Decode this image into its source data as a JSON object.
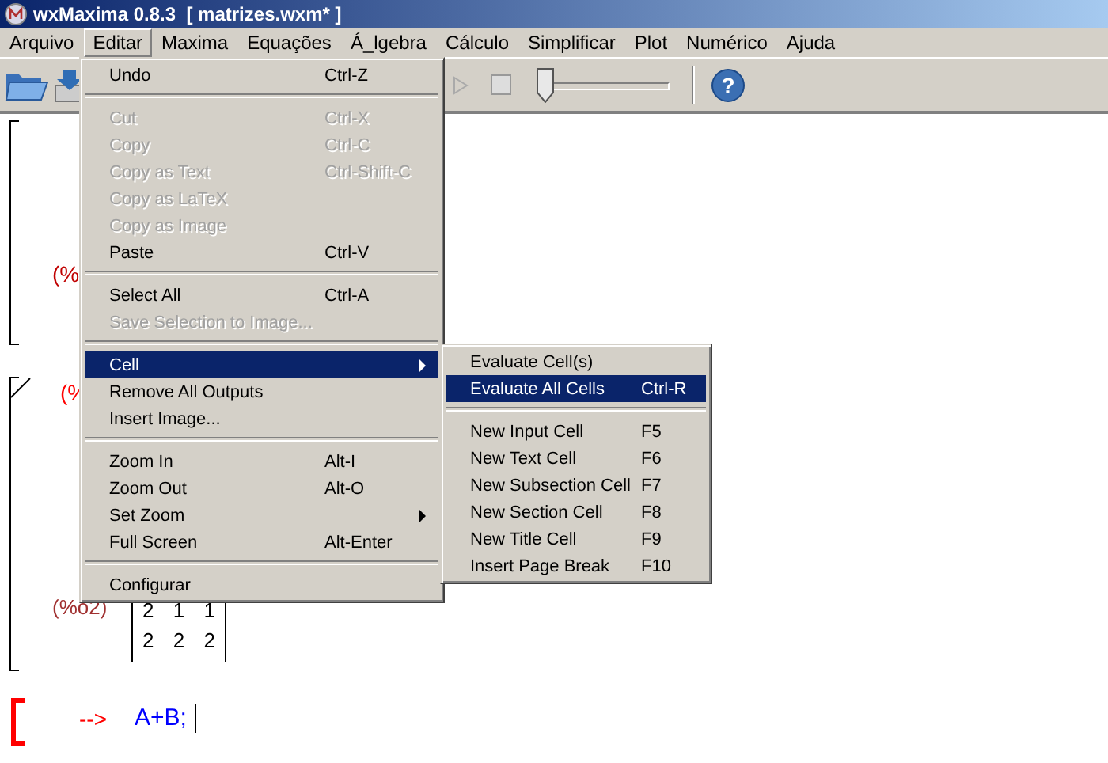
{
  "window": {
    "title": "wxMaxima 0.8.3  [ matrizes.wxm* ]"
  },
  "menubar": [
    {
      "label": "Arquivo",
      "selected": false
    },
    {
      "label": "Editar",
      "selected": true
    },
    {
      "label": "Maxima",
      "selected": false
    },
    {
      "label": "Equações",
      "selected": false
    },
    {
      "label": "Á_lgebra",
      "selected": false
    },
    {
      "label": "Cálculo",
      "selected": false
    },
    {
      "label": "Simplificar",
      "selected": false
    },
    {
      "label": "Plot",
      "selected": false
    },
    {
      "label": "Numérico",
      "selected": false
    },
    {
      "label": "Ajuda",
      "selected": false
    }
  ],
  "toolbar": {
    "checkbox": {
      "checked": false
    },
    "slider": {
      "level": 0
    },
    "help_glyph": "?"
  },
  "edit_menu": [
    {
      "kind": "item",
      "label": "Undo",
      "shortcut": "Ctrl-Z",
      "disabled": false,
      "selected": false
    },
    {
      "kind": "separator"
    },
    {
      "kind": "item",
      "label": "Cut",
      "shortcut": "Ctrl-X",
      "disabled": true,
      "selected": false
    },
    {
      "kind": "item",
      "label": "Copy",
      "shortcut": "Ctrl-C",
      "disabled": true,
      "selected": false
    },
    {
      "kind": "item",
      "label": "Copy as Text",
      "shortcut": "Ctrl-Shift-C",
      "disabled": true,
      "selected": false
    },
    {
      "kind": "item",
      "label": "Copy as LaTeX",
      "disabled": true,
      "selected": false
    },
    {
      "kind": "item",
      "label": "Copy as Image",
      "disabled": true,
      "selected": false
    },
    {
      "kind": "item",
      "label": "Paste",
      "shortcut": "Ctrl-V",
      "disabled": false,
      "selected": false
    },
    {
      "kind": "separator"
    },
    {
      "kind": "item",
      "label": "Select All",
      "shortcut": "Ctrl-A",
      "disabled": false,
      "selected": false
    },
    {
      "kind": "item",
      "label": "Save Selection to Image...",
      "disabled": true,
      "selected": false
    },
    {
      "kind": "separator"
    },
    {
      "kind": "submenu",
      "label": "Cell",
      "disabled": false,
      "selected": true
    },
    {
      "kind": "item",
      "label": "Remove All Outputs",
      "disabled": false,
      "selected": false
    },
    {
      "kind": "item",
      "label": "Insert Image...",
      "disabled": false,
      "selected": false
    },
    {
      "kind": "separator"
    },
    {
      "kind": "item",
      "label": "Zoom In",
      "shortcut": "Alt-I",
      "disabled": false,
      "selected": false
    },
    {
      "kind": "item",
      "label": "Zoom Out",
      "shortcut": "Alt-O",
      "disabled": false,
      "selected": false
    },
    {
      "kind": "submenu",
      "label": "Set Zoom",
      "disabled": false,
      "selected": false
    },
    {
      "kind": "item",
      "label": "Full Screen",
      "shortcut": "Alt-Enter",
      "disabled": false,
      "selected": false
    },
    {
      "kind": "separator"
    },
    {
      "kind": "item",
      "label": "Configurar",
      "disabled": false,
      "selected": false
    }
  ],
  "cell_submenu": [
    {
      "kind": "item",
      "label": "Evaluate Cell(s)",
      "disabled": false,
      "selected": false
    },
    {
      "kind": "item",
      "label": "Evaluate All Cells",
      "shortcut": "Ctrl-R",
      "disabled": false,
      "selected": true
    },
    {
      "kind": "separator"
    },
    {
      "kind": "item",
      "label": "New Input Cell",
      "shortcut": "F5",
      "disabled": false,
      "selected": false
    },
    {
      "kind": "item",
      "label": "New Text Cell",
      "shortcut": "F6",
      "disabled": false,
      "selected": false
    },
    {
      "kind": "item",
      "label": "New Subsection Cell",
      "shortcut": "F7",
      "disabled": false,
      "selected": false
    },
    {
      "kind": "item",
      "label": "New Section Cell",
      "shortcut": "F8",
      "disabled": false,
      "selected": false
    },
    {
      "kind": "item",
      "label": "New Title Cell",
      "shortcut": "F9",
      "disabled": false,
      "selected": false
    },
    {
      "kind": "item",
      "label": "Insert Page Break",
      "shortcut": "F10",
      "disabled": false,
      "selected": false
    }
  ],
  "worksheet": {
    "label_1": "(%",
    "label_2": "(%",
    "output_label": "(%o2)",
    "matrix": [
      [
        "2",
        "1",
        "1"
      ],
      [
        "2",
        "2",
        "2"
      ]
    ],
    "prompt": "-->",
    "input": "A+B;"
  }
}
